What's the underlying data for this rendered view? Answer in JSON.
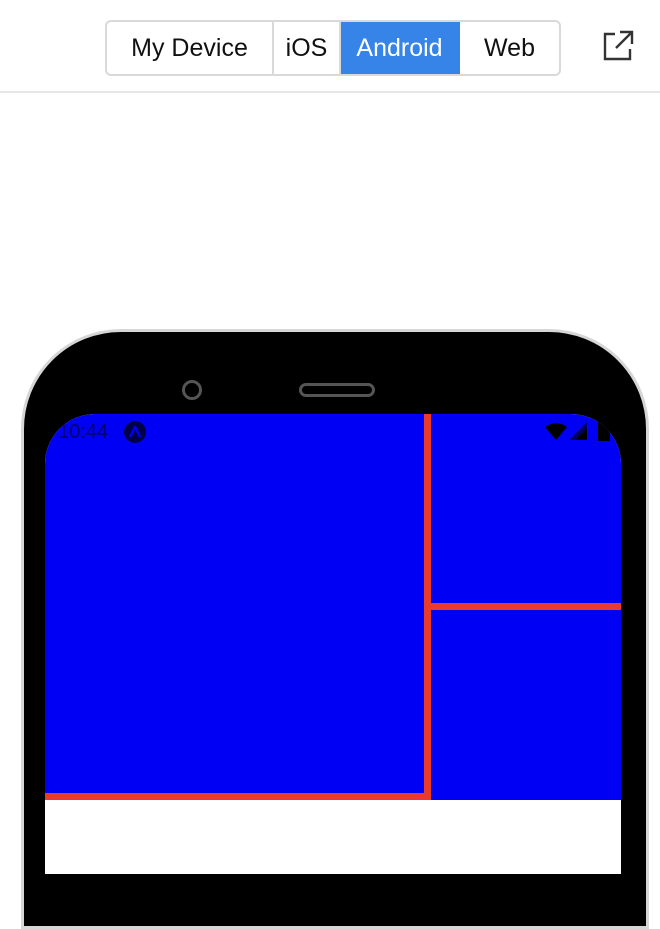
{
  "toolbar": {
    "platform_tabs": [
      {
        "label": "My Device",
        "active": false
      },
      {
        "label": "iOS",
        "active": false
      },
      {
        "label": "Android",
        "active": true
      },
      {
        "label": "Web",
        "active": false
      }
    ],
    "open_external_icon": "external-link-icon"
  },
  "device": {
    "status_bar": {
      "time": "10:44",
      "app_icon": "expo-logo-icon",
      "wifi_icon": "wifi-icon",
      "cell_icon": "cellular-signal-icon",
      "battery_icon": "battery-icon"
    }
  },
  "colors": {
    "accent": "#3784e8",
    "app_background": "#0000f5",
    "divider_lines": "#ea3a2a"
  }
}
